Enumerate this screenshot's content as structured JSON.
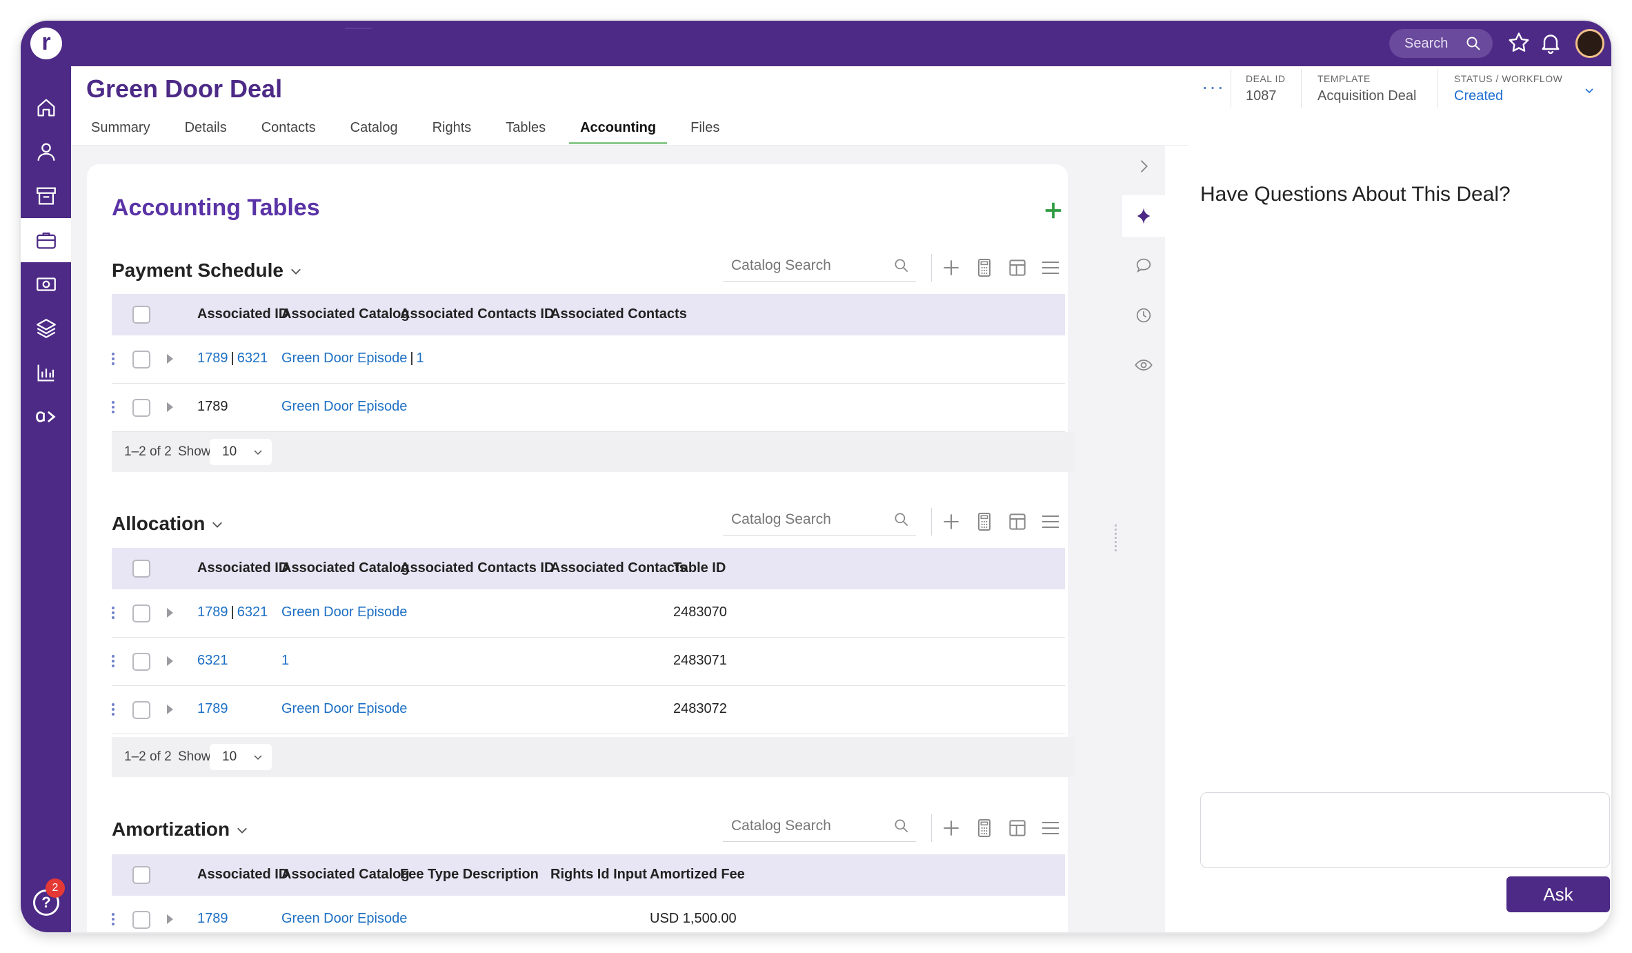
{
  "topbar": {
    "search_label": "Search",
    "icons": [
      "search-icon",
      "star-icon",
      "bell-icon",
      "avatar"
    ]
  },
  "nav": {
    "logo": "r",
    "items": [
      "home-icon",
      "contacts-icon",
      "archive-icon",
      "deals-icon",
      "money-icon",
      "layers-icon",
      "reports-icon",
      "ai-icon"
    ],
    "active": "deals-icon",
    "help_label": "?",
    "help_badge": "2"
  },
  "header": {
    "title": "Green Door Deal",
    "more": "···",
    "deal_id_label": "DEAL ID",
    "deal_id_value": "1087",
    "template_label": "TEMPLATE",
    "template_value": "Acquisition Deal",
    "status_label": "STATUS / WORKFLOW",
    "status_value": "Created"
  },
  "tabs": [
    {
      "label": "Summary"
    },
    {
      "label": "Details"
    },
    {
      "label": "Contacts"
    },
    {
      "label": "Catalog"
    },
    {
      "label": "Rights"
    },
    {
      "label": "Tables"
    },
    {
      "label": "Accounting",
      "active": true
    },
    {
      "label": "Files"
    }
  ],
  "main": {
    "title": "Accounting Tables",
    "sections": [
      {
        "title": "Payment Schedule",
        "search_placeholder": "Catalog Search",
        "columns": [
          "Associated ID",
          "Associated Catalog",
          "Associated Contacts ID",
          "Associated Contacts"
        ],
        "rows": [
          {
            "id_a": "1789",
            "id_sep": "|",
            "id_b": "6321",
            "catalog": "Green Door Episode",
            "catalog_sep": "|",
            "catalog_b": "1"
          },
          {
            "id_plain": "1789",
            "catalog": "Green Door Episode"
          }
        ],
        "pager": {
          "range": "1–2 of 2",
          "show_label": "Show",
          "page_size": "10"
        }
      },
      {
        "title": "Allocation",
        "search_placeholder": "Catalog Search",
        "columns": [
          "Associated ID",
          "Associated Catalog",
          "Associated Contacts ID",
          "Associated Contacts",
          "Table ID"
        ],
        "rows": [
          {
            "id_a": "1789",
            "id_sep": "|",
            "id_b": "6321",
            "catalog": "Green Door Episode",
            "table_id": "2483070"
          },
          {
            "id_a": "6321",
            "catalog": "1",
            "table_id": "2483071"
          },
          {
            "id_a": "1789",
            "catalog": "Green Door Episode",
            "table_id": "2483072"
          }
        ],
        "pager": {
          "range": "1–2 of 2",
          "show_label": "Show",
          "page_size": "10"
        }
      },
      {
        "title": "Amortization",
        "search_placeholder": "Catalog Search",
        "columns": [
          "Associated ID",
          "Associated Catalog",
          "Fee Type Description",
          "Rights Id Input",
          "Amortized Fee"
        ],
        "rows": [
          {
            "id_a": "1789",
            "catalog": "Green Door Episode",
            "fee": "USD 1,500.00"
          }
        ]
      }
    ]
  },
  "side_panel": {
    "title": "Have Questions About This Deal?",
    "input_value": "",
    "ask_label": "Ask"
  },
  "colors": {
    "brand": "#4d2a86",
    "link": "#1c6fc4",
    "title_purple": "#5a33a6",
    "add_green": "#2e9b3f",
    "header_row": "#e8e6f4"
  }
}
